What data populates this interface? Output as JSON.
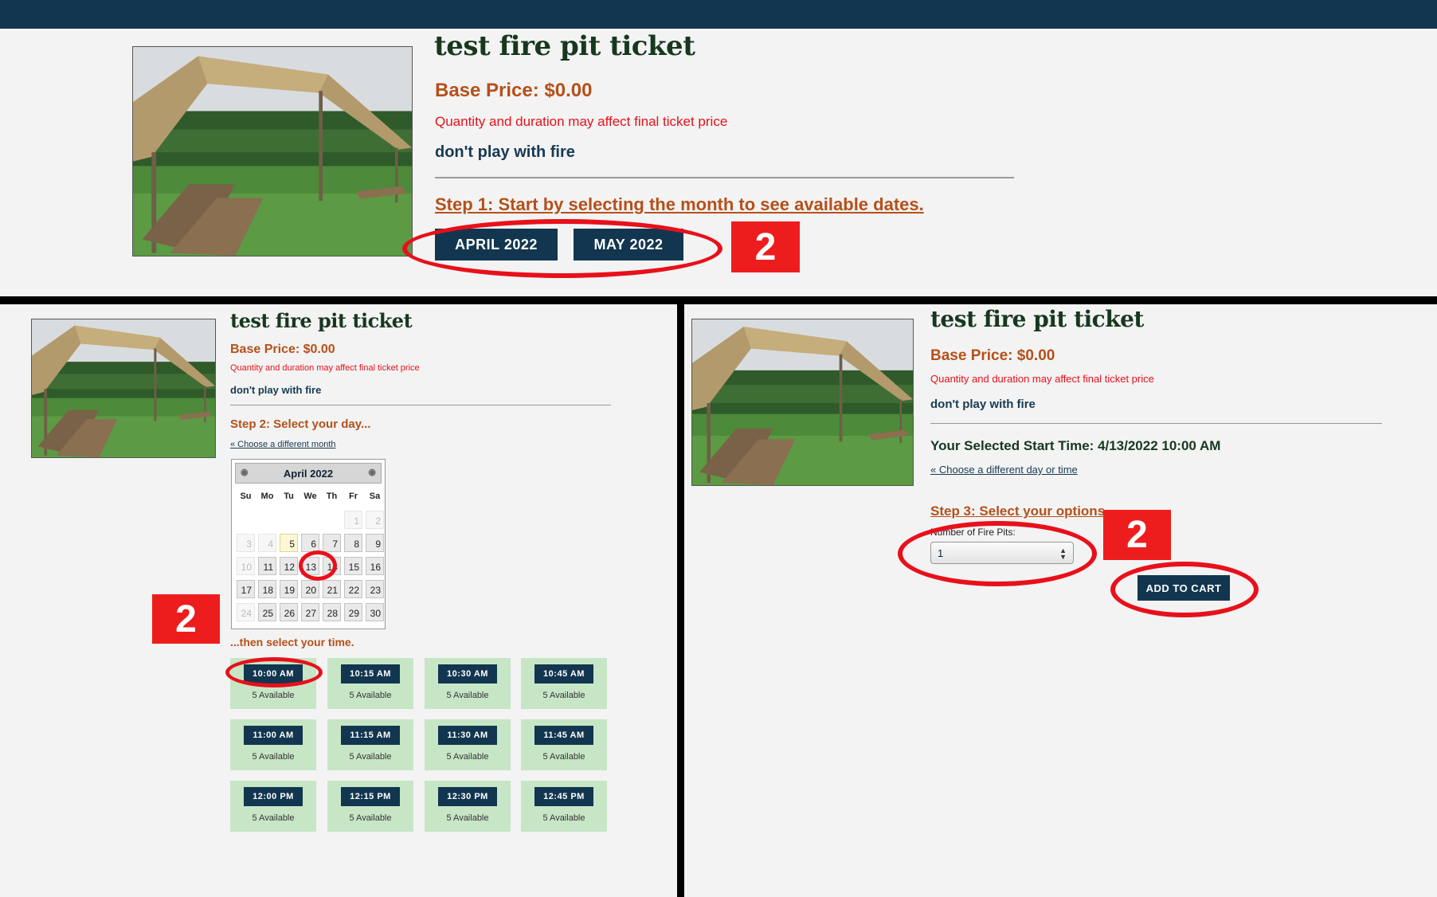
{
  "product": {
    "title": "test fire pit ticket",
    "base_price": "Base Price: $0.00",
    "note": "Quantity and duration may affect final ticket price",
    "description": "don't play with fire"
  },
  "step1": {
    "heading": "Step 1: Start by selecting the month to see available dates.",
    "months": [
      "APRIL 2022",
      "MAY 2022"
    ]
  },
  "step2": {
    "heading": "Step 2: Select your day...",
    "change_month_link": "« Choose a different month",
    "calendar": {
      "month": "April 2022",
      "prev_icon": "circle-icon",
      "next_icon": "circle-icon",
      "weekdays": [
        "Su",
        "Mo",
        "Tu",
        "We",
        "Th",
        "Fr",
        "Sa"
      ],
      "days": [
        {
          "d": "1",
          "s": "na"
        },
        {
          "d": "2",
          "s": "na"
        },
        {
          "d": "3",
          "s": "na"
        },
        {
          "d": "4",
          "s": "na"
        },
        {
          "d": "5",
          "s": "today"
        },
        {
          "d": "6",
          "s": "av"
        },
        {
          "d": "7",
          "s": "av"
        },
        {
          "d": "8",
          "s": "av"
        },
        {
          "d": "9",
          "s": "av"
        },
        {
          "d": "10",
          "s": "na"
        },
        {
          "d": "11",
          "s": "av"
        },
        {
          "d": "12",
          "s": "av"
        },
        {
          "d": "13",
          "s": "av"
        },
        {
          "d": "14",
          "s": "av"
        },
        {
          "d": "15",
          "s": "av"
        },
        {
          "d": "16",
          "s": "av"
        },
        {
          "d": "17",
          "s": "av"
        },
        {
          "d": "18",
          "s": "av"
        },
        {
          "d": "19",
          "s": "av"
        },
        {
          "d": "20",
          "s": "av"
        },
        {
          "d": "21",
          "s": "av"
        },
        {
          "d": "22",
          "s": "av"
        },
        {
          "d": "23",
          "s": "av"
        },
        {
          "d": "24",
          "s": "na"
        },
        {
          "d": "25",
          "s": "av"
        },
        {
          "d": "26",
          "s": "av"
        },
        {
          "d": "27",
          "s": "av"
        },
        {
          "d": "28",
          "s": "av"
        },
        {
          "d": "29",
          "s": "av"
        },
        {
          "d": "30",
          "s": "av"
        }
      ]
    },
    "time_heading": "...then select your time.",
    "slots": [
      {
        "time": "10:00 AM",
        "avail": "5 Available"
      },
      {
        "time": "10:15 AM",
        "avail": "5 Available"
      },
      {
        "time": "10:30 AM",
        "avail": "5 Available"
      },
      {
        "time": "10:45 AM",
        "avail": "5 Available"
      },
      {
        "time": "11:00 AM",
        "avail": "5 Available"
      },
      {
        "time": "11:15 AM",
        "avail": "5 Available"
      },
      {
        "time": "11:30 AM",
        "avail": "5 Available"
      },
      {
        "time": "11:45 AM",
        "avail": "5 Available"
      },
      {
        "time": "12:00 PM",
        "avail": "5 Available"
      },
      {
        "time": "12:15 PM",
        "avail": "5 Available"
      },
      {
        "time": "12:30 PM",
        "avail": "5 Available"
      },
      {
        "time": "12:45 PM",
        "avail": "5 Available"
      }
    ]
  },
  "step3": {
    "selected_time": "Your Selected Start Time: 4/13/2022 10:00 AM",
    "change_day_link": "« Choose a different day or time",
    "heading": "Step 3: Select your options",
    "fire_pits_label": "Number of Fire Pits:",
    "fire_pits_value": "1",
    "add_to_cart": "ADD TO CART"
  },
  "annotations": {
    "badge": "2"
  },
  "colors": {
    "navy": "#12364f",
    "orange": "#b5501a",
    "red": "#e8101b",
    "green_slot": "#c7e6c6",
    "annotation_red": "#ee1d1d"
  },
  "icons": {
    "photo": "canopy-picnic-photo",
    "select_arrows": "up-down-arrows-icon"
  }
}
